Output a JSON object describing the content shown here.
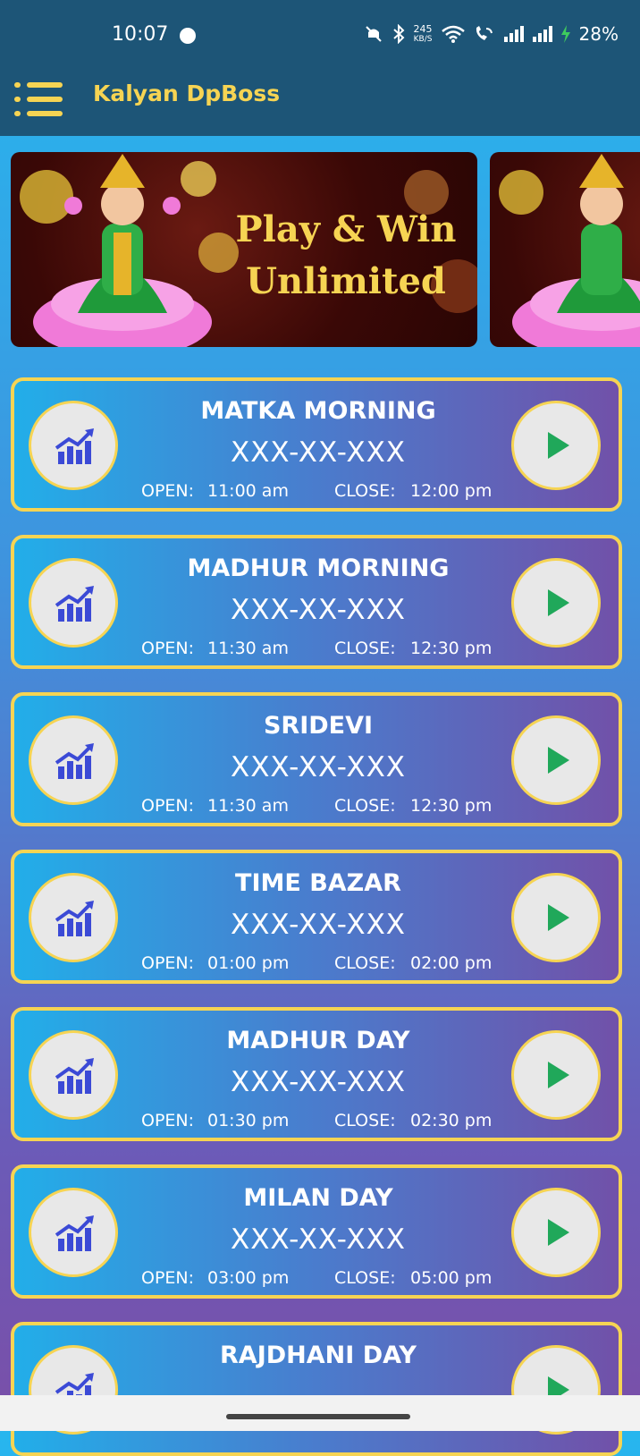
{
  "status_bar": {
    "time": "10:07",
    "net_speed_value": "245",
    "net_speed_unit": "KB/S",
    "battery": "28%"
  },
  "app_bar": {
    "title": "Kalyan DpBoss"
  },
  "banner": {
    "line1": "Play & Win",
    "line2": "Unlimited"
  },
  "colors": {
    "accent_yellow": "#f6d453",
    "appbar": "#1d5577",
    "play_green": "#20a85a",
    "chart_blue": "#3b4ad6"
  },
  "games": [
    {
      "name": "MATKA MORNING",
      "result": "XXX-XX-XXX",
      "open_label": "OPEN:",
      "open_time": "11:00 am",
      "close_label": "CLOSE:",
      "close_time": "12:00 pm"
    },
    {
      "name": "MADHUR MORNING",
      "result": "XXX-XX-XXX",
      "open_label": "OPEN:",
      "open_time": "11:30 am",
      "close_label": "CLOSE:",
      "close_time": "12:30 pm"
    },
    {
      "name": "SRIDEVI",
      "result": "XXX-XX-XXX",
      "open_label": "OPEN:",
      "open_time": "11:30 am",
      "close_label": "CLOSE:",
      "close_time": "12:30 pm"
    },
    {
      "name": "TIME BAZAR",
      "result": "XXX-XX-XXX",
      "open_label": "OPEN:",
      "open_time": "01:00 pm",
      "close_label": "CLOSE:",
      "close_time": "02:00 pm"
    },
    {
      "name": "MADHUR DAY",
      "result": "XXX-XX-XXX",
      "open_label": "OPEN:",
      "open_time": "01:30 pm",
      "close_label": "CLOSE:",
      "close_time": "02:30 pm"
    },
    {
      "name": "MILAN DAY",
      "result": "XXX-XX-XXX",
      "open_label": "OPEN:",
      "open_time": "03:00 pm",
      "close_label": "CLOSE:",
      "close_time": "05:00 pm"
    },
    {
      "name": "RAJDHANI DAY"
    }
  ]
}
